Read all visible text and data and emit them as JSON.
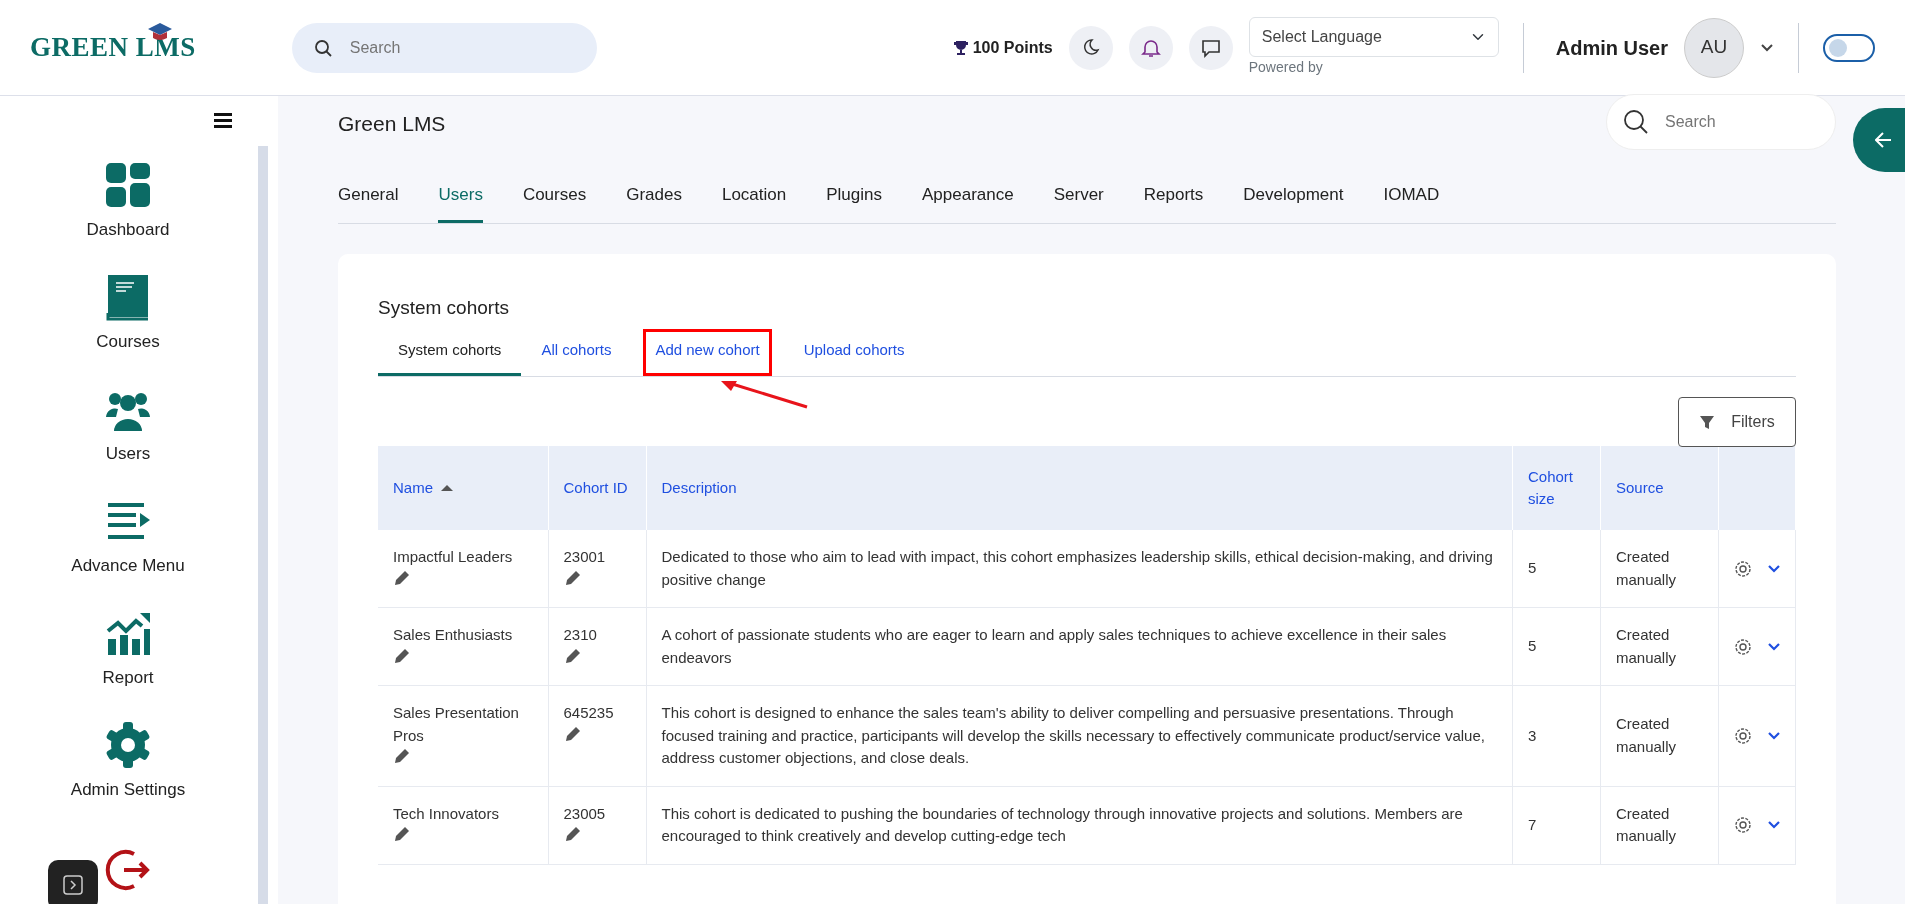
{
  "header": {
    "logo": "GREEN LMS",
    "search": {
      "placeholder": "Search"
    },
    "points": "100 Points",
    "language": {
      "value": "Select Language",
      "caption": "Powered by"
    },
    "user": {
      "name": "Admin User",
      "initials": "AU"
    },
    "theme_switch": {
      "on": false
    }
  },
  "sidebar": {
    "items": [
      {
        "kind": "dashboard",
        "label": "Dashboard"
      },
      {
        "kind": "courses",
        "label": "Courses"
      },
      {
        "kind": "users",
        "label": "Users"
      },
      {
        "kind": "menu",
        "label": "Advance Menu"
      },
      {
        "kind": "report",
        "label": "Report"
      },
      {
        "kind": "settings",
        "label": "Admin Settings"
      },
      {
        "kind": "logout"
      }
    ]
  },
  "page": {
    "title": "Green LMS",
    "search": {
      "placeholder": "Search"
    },
    "tabs": [
      {
        "label": "General",
        "selected": false
      },
      {
        "label": "Users",
        "selected": true
      },
      {
        "label": "Courses",
        "selected": false
      },
      {
        "label": "Grades",
        "selected": false
      },
      {
        "label": "Location",
        "selected": false
      },
      {
        "label": "Plugins",
        "selected": false
      },
      {
        "label": "Appearance",
        "selected": false
      },
      {
        "label": "Server",
        "selected": false
      },
      {
        "label": "Reports",
        "selected": false
      },
      {
        "label": "Development",
        "selected": false
      },
      {
        "label": "IOMAD",
        "selected": false
      }
    ]
  },
  "card": {
    "heading": "System cohorts",
    "subtabs": [
      {
        "label": "System cohorts",
        "selected": true,
        "highlighted": false
      },
      {
        "label": "All cohorts",
        "selected": false,
        "highlighted": false
      },
      {
        "label": "Add new cohort",
        "selected": false,
        "highlighted": true
      },
      {
        "label": "Upload cohorts",
        "selected": false,
        "highlighted": false
      }
    ],
    "filters_button": "Filters",
    "table": {
      "columns": [
        "Name",
        "Cohort ID",
        "Description",
        "Cohort size",
        "Source"
      ],
      "rows": [
        {
          "name": "Impactful Leaders",
          "id": "23001",
          "description": "Dedicated to those who aim to lead with impact, this cohort emphasizes leadership skills, ethical decision-making, and driving positive change",
          "size": "5",
          "source": "Created manually"
        },
        {
          "name": "Sales Enthusiasts",
          "id": "2310",
          "description": "A cohort of passionate students who are eager to learn and apply sales techniques to achieve excellence in their sales endeavors",
          "size": "5",
          "source": "Created manually"
        },
        {
          "name": "Sales Presentation Pros",
          "id": "645235",
          "description": "This cohort is designed to enhance the sales team's ability to deliver compelling and persuasive presentations. Through focused training and practice, participants will develop the skills necessary to effectively communicate product/service value, address customer objections, and close deals.",
          "size": "3",
          "source": "Created manually"
        },
        {
          "name": "Tech Innovators",
          "id": "23005",
          "description": "This cohort is dedicated to pushing the boundaries of technology through innovative projects and solutions. Members are encouraged to think creatively and develop cutting-edge tech",
          "size": "7",
          "source": "Created manually"
        }
      ]
    }
  }
}
